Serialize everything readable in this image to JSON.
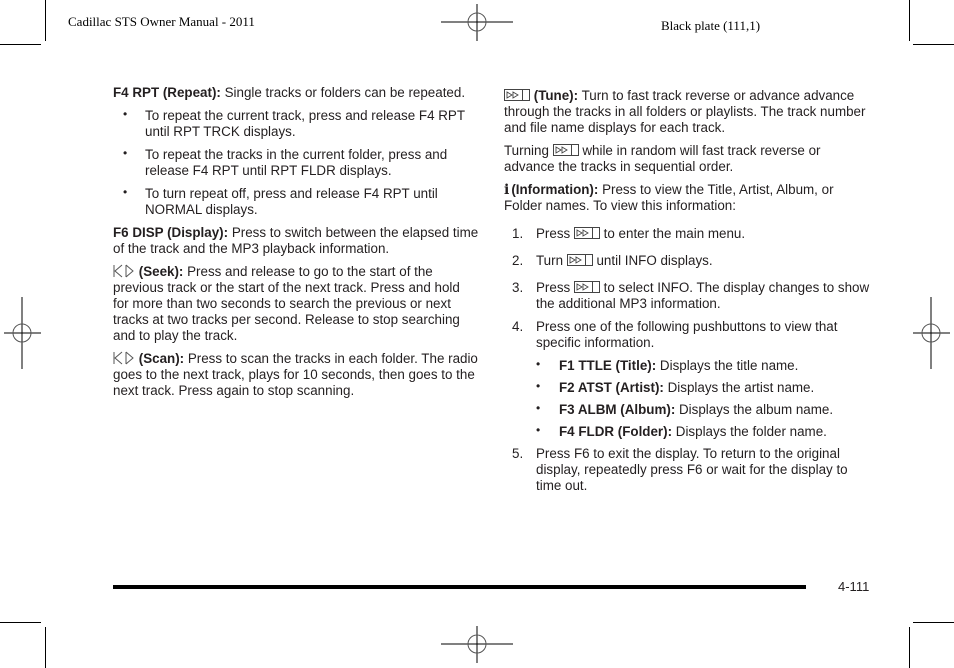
{
  "header": {
    "left_title": "Cadillac STS Owner Manual - 2011",
    "right_title": "Black plate (111,1)"
  },
  "icons": {
    "tune": "tune-knob-icon",
    "seek": "seek-arrows-icon",
    "info": "info-icon"
  },
  "left_column": {
    "repeat": {
      "label": "F4 RPT (Repeat):",
      "text": " Single tracks or folders can be repeated.",
      "bullets": [
        "To repeat the current track, press and release F4 RPT until RPT TRCK displays.",
        "To repeat the tracks in the current folder, press and release F4 RPT until RPT FLDR displays.",
        "To turn repeat off, press and release F4 RPT until NORMAL displays."
      ]
    },
    "display": {
      "label": "F6 DISP (Display):",
      "text": " Press to switch between the elapsed time of the track and the MP3 playback information."
    },
    "seek": {
      "label": "(Seek):",
      "text": " Press and release to go to the start of the previous track or the start of the next track. Press and hold for more than two seconds to search the previous or next tracks at two tracks per second. Release to stop searching and to play the track."
    },
    "scan": {
      "label": "(Scan):",
      "text": " Press to scan the tracks in each folder. The radio goes to the next track, plays for 10 seconds, then goes to the next track. Press again to stop scanning."
    }
  },
  "right_column": {
    "tune": {
      "label": "(Tune):",
      "text": " Turn to fast track reverse or advance advance through the tracks in all folders or playlists. The track number and file name displays for each track."
    },
    "turning": {
      "before": "Turning ",
      "after": " while in random will fast track reverse or advance the tracks in sequential order."
    },
    "info": {
      "label": "(Information):",
      "text": " Press to view the Title, Artist, Album, or Folder names. To view this information:"
    },
    "steps": [
      {
        "n": "1.",
        "before": "Press ",
        "after": " to enter the main menu."
      },
      {
        "n": "2.",
        "before": "Turn ",
        "after": " until INFO displays."
      },
      {
        "n": "3.",
        "before": "Press ",
        "after": " to select INFO. The display changes to show the additional MP3 information."
      },
      {
        "n": "4.",
        "text": "Press one of the following pushbuttons to view that specific information."
      },
      {
        "n": "5.",
        "text": "Press F6 to exit the display. To return to the original display, repeatedly press F6 or wait for the display to time out."
      }
    ],
    "sub_bullets": [
      {
        "label": "F1 TTLE (Title):",
        "text": " Displays the title name."
      },
      {
        "label": "F2 ATST (Artist):",
        "text": " Displays the artist name."
      },
      {
        "label": "F3 ALBM (Album):",
        "text": " Displays the album name."
      },
      {
        "label": "F4 FLDR (Folder):",
        "text": " Displays the folder name."
      }
    ]
  },
  "footer": {
    "page_number": "4-111"
  }
}
